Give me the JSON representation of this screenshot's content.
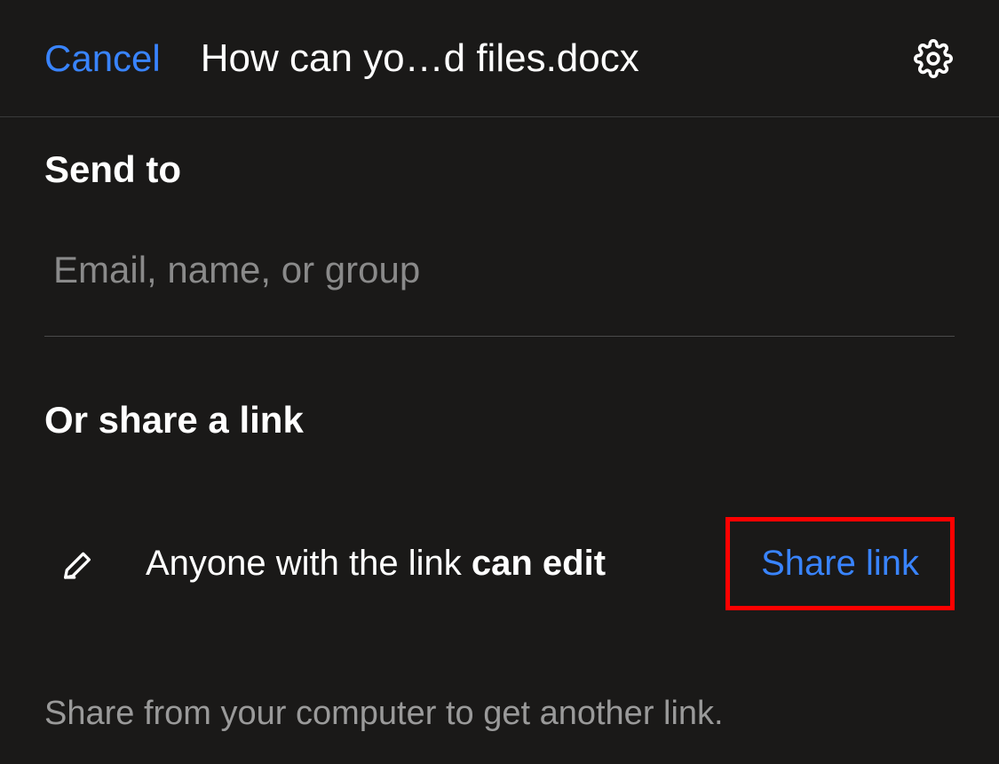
{
  "header": {
    "cancel_label": "Cancel",
    "title": "How can yo…d files.docx"
  },
  "send_to": {
    "heading": "Send to",
    "email_placeholder": "Email, name, or group"
  },
  "share_link": {
    "heading": "Or share a link",
    "permission_prefix": "Anyone with the link ",
    "permission_bold": "can edit",
    "share_button_label": "Share link"
  },
  "footer": {
    "text": "Share from your computer to get another link."
  },
  "colors": {
    "accent": "#3984ff",
    "background": "#1a1918",
    "highlight_border": "#ff0000"
  }
}
